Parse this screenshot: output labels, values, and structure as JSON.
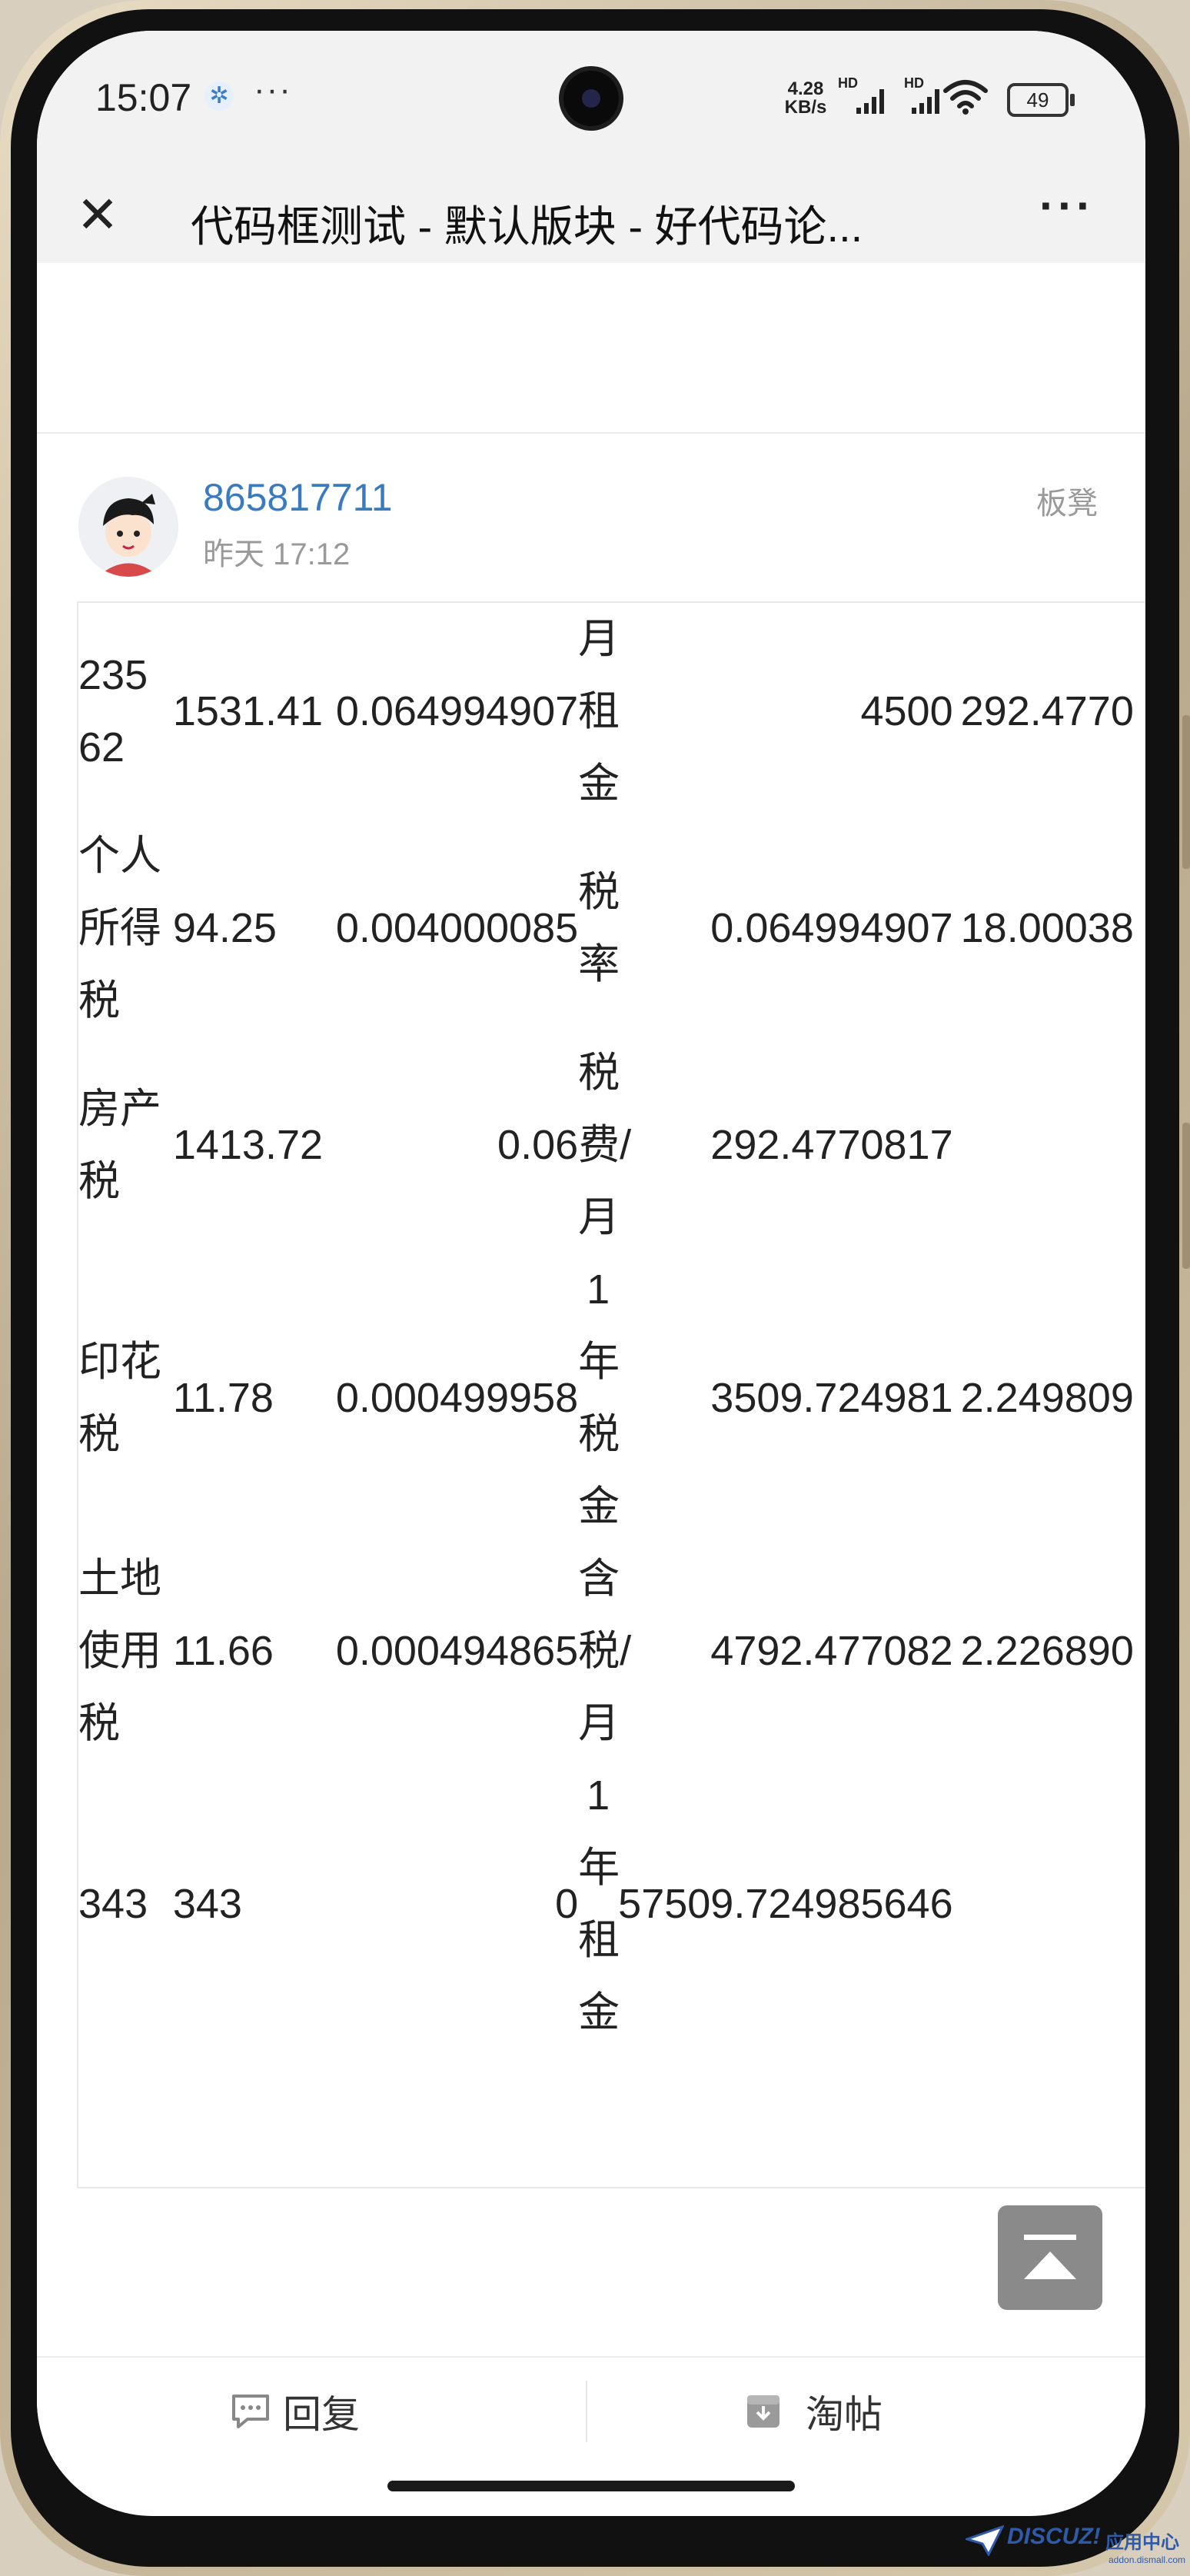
{
  "status_bar": {
    "time": "15:07",
    "more": "···",
    "net_speed_value": "4.28",
    "net_speed_unit": "KB/s",
    "hd1": "HD",
    "hd2": "HD",
    "battery": "49"
  },
  "nav": {
    "title": "代码框测试 - 默认版块 - 好代码论...",
    "close_icon": "close-icon",
    "more": "···"
  },
  "post": {
    "username": "865817711",
    "time": "昨天 17:12",
    "floor": "板凳"
  },
  "table": {
    "rows": [
      [
        "23562",
        "1531.41",
        "0.064994907",
        "月租金",
        "4500",
        "292.4770"
      ],
      [
        "个人所得税",
        "94.25",
        "0.004000085",
        "税率",
        "0.064994907",
        "18.00038"
      ],
      [
        "房产税",
        "1413.72",
        "0.06",
        "税费/月",
        "292.4770817",
        ""
      ],
      [
        "印花税",
        "11.78",
        "0.000499958",
        "1年税金",
        "3509.724981",
        "2.249809"
      ],
      [
        "土地使用税",
        "11.66",
        "0.000494865",
        "含税/月",
        "4792.477082",
        "2.226890"
      ],
      [
        "343",
        "343",
        "0",
        "1年租金",
        "57509.724985646",
        ""
      ]
    ]
  },
  "back_to_top": {
    "icon": "back-to-top-icon"
  },
  "bottom_bar": {
    "reply": "回复",
    "grab": "淘帖"
  },
  "watermark": {
    "brand": "DISCUZ!",
    "sub": "应用中心",
    "url": "addon.dismall.com"
  },
  "colors": {
    "link": "#3a7bbf",
    "muted": "#9a9a9a",
    "bar_bg": "#f2f2f2"
  }
}
